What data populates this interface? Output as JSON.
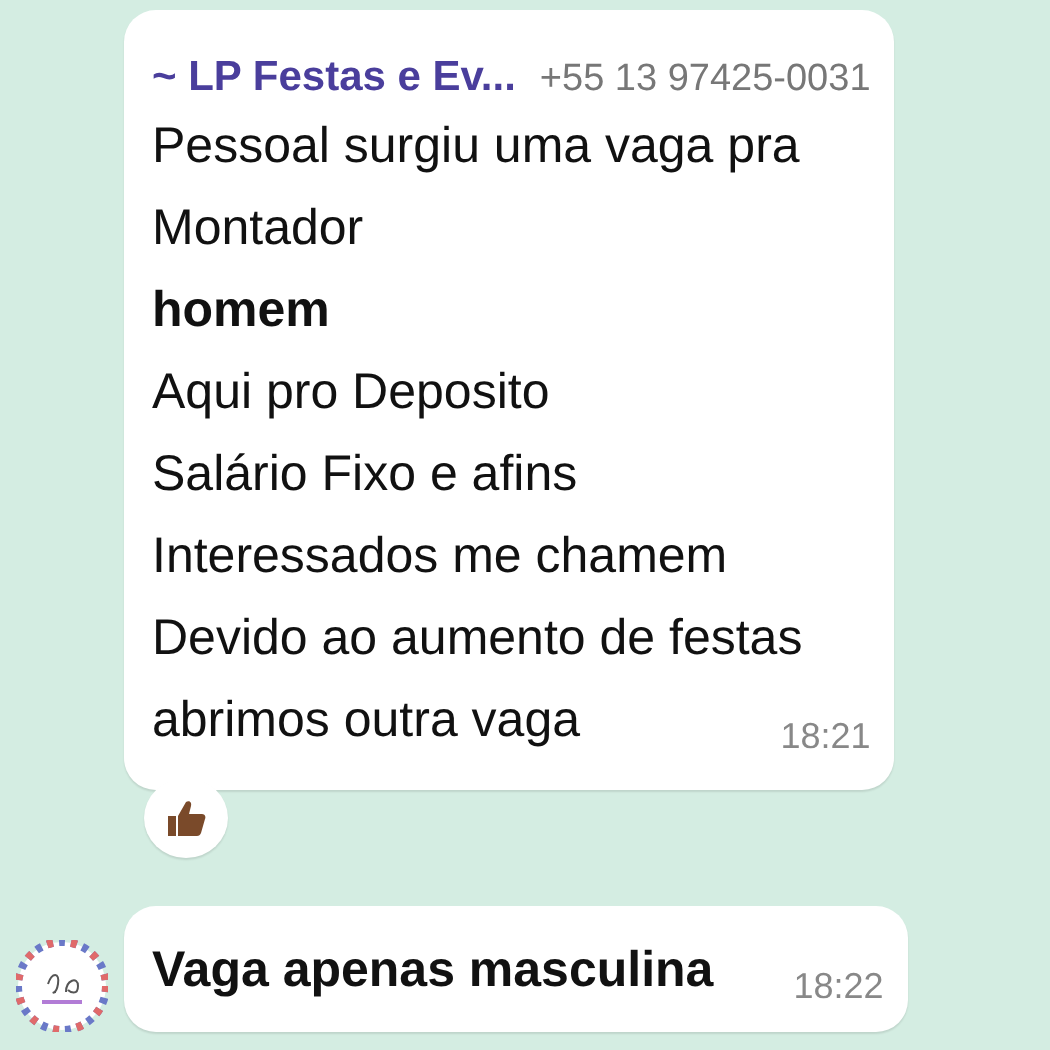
{
  "messages": [
    {
      "sender": "~ LP Festas e Ev...",
      "phone": "+55 13 97425-0031",
      "lines": [
        {
          "text": "Pessoal surgiu uma vaga pra",
          "bold": false
        },
        {
          "text": "Montador",
          "bold": false
        },
        {
          "text": "homem",
          "bold": true
        },
        {
          "text": "Aqui pro Deposito",
          "bold": false
        },
        {
          "text": "Salário Fixo e afins",
          "bold": false
        },
        {
          "text": "Interessados me chamem",
          "bold": false
        },
        {
          "text": "Devido ao aumento de festas",
          "bold": false
        },
        {
          "text": "abrimos outra vaga",
          "bold": false
        }
      ],
      "time": "18:21",
      "reaction": true,
      "avatar": false
    },
    {
      "lines": [
        {
          "text": "Vaga apenas masculina",
          "bold": true
        }
      ],
      "time": "18:22",
      "reaction": false,
      "avatar": true
    }
  ]
}
